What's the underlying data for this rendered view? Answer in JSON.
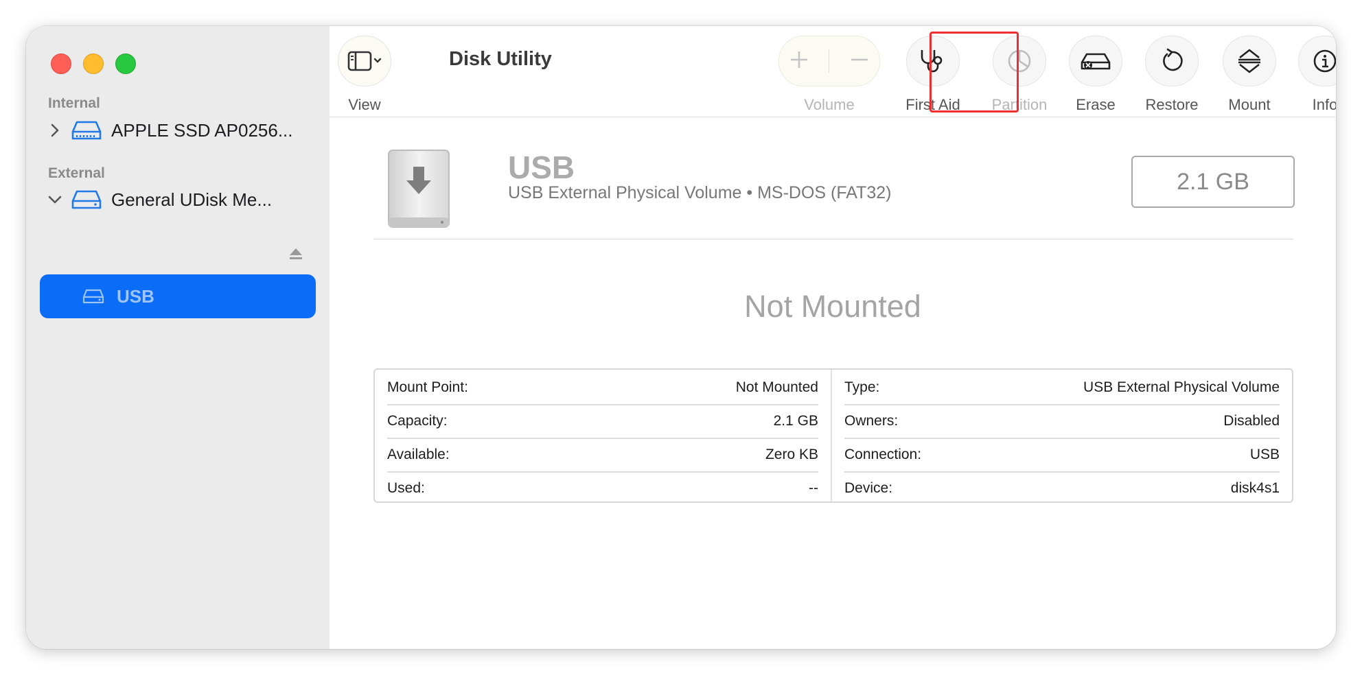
{
  "window": {
    "title": "Disk Utility"
  },
  "sidebar": {
    "sections": {
      "internal": "Internal",
      "external": "External"
    },
    "internal_disk": {
      "label": "APPLE SSD AP0256..."
    },
    "external_disk": {
      "label": "General UDisk Me..."
    },
    "selected_volume": {
      "label": "USB"
    }
  },
  "toolbar": {
    "view": "View",
    "volume": "Volume",
    "first_aid": "First Aid",
    "partition": "Partition",
    "erase": "Erase",
    "restore": "Restore",
    "mount": "Mount",
    "info": "Info"
  },
  "volume": {
    "name": "USB",
    "description": "USB External Physical Volume • MS-DOS (FAT32)",
    "size": "2.1 GB",
    "status": "Not Mounted"
  },
  "details": {
    "left": [
      {
        "label": "Mount Point:",
        "value": "Not Mounted"
      },
      {
        "label": "Capacity:",
        "value": "2.1 GB"
      },
      {
        "label": "Available:",
        "value": "Zero KB"
      },
      {
        "label": "Used:",
        "value": "--"
      }
    ],
    "right": [
      {
        "label": "Type:",
        "value": "USB External Physical Volume"
      },
      {
        "label": "Owners:",
        "value": "Disabled"
      },
      {
        "label": "Connection:",
        "value": "USB"
      },
      {
        "label": "Device:",
        "value": "disk4s1"
      }
    ]
  },
  "colors": {
    "accent": "#0a6cf7",
    "highlight": "#ee2f2f"
  }
}
